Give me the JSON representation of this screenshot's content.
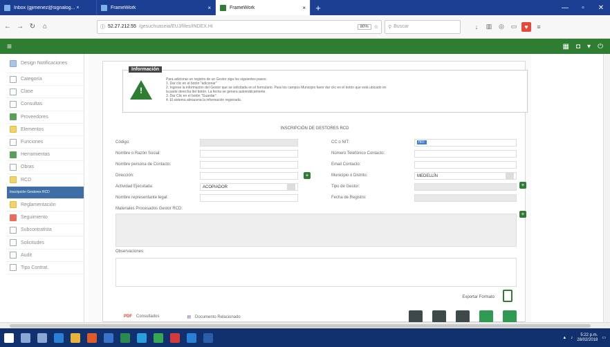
{
  "browser": {
    "tabs": [
      {
        "label": "Inbox (gjimenez@signalog... ×"
      },
      {
        "label": "FrameWork"
      },
      {
        "label": "FrameWork"
      }
    ],
    "url_host": "52.27.212.55",
    "url_path": "/gesuchuaseia/EUJ/files/INDEX.HI",
    "zoom": "80%",
    "search_placeholder": "Buscar"
  },
  "sidebar": {
    "items": [
      {
        "label": "Design Notificaciones",
        "icon": "bell-icon",
        "color": "blue"
      },
      {
        "label": "Categoría",
        "icon": "list-icon",
        "color": ""
      },
      {
        "label": "Clase",
        "icon": "tag-icon",
        "color": ""
      },
      {
        "label": "Consultas",
        "icon": "search-icon",
        "color": ""
      },
      {
        "label": "Proveedores",
        "icon": "chart-icon",
        "color": "green"
      },
      {
        "label": "Elementos",
        "icon": "cube-icon",
        "color": "yellow"
      },
      {
        "label": "Funciones",
        "icon": "grid-icon",
        "color": ""
      },
      {
        "label": "Herramientas",
        "icon": "wrench-icon",
        "color": "green"
      },
      {
        "label": "Obras",
        "icon": "building-icon",
        "color": ""
      },
      {
        "label": "RCD",
        "icon": "folder-icon",
        "color": "yellow"
      },
      {
        "label": "Inscripción Gestores RCD",
        "icon": "",
        "color": "",
        "active": true
      },
      {
        "label": "Reglamentación",
        "icon": "pen-icon",
        "color": "yellow"
      },
      {
        "label": "Seguimiento",
        "icon": "truck-icon",
        "color": "red"
      },
      {
        "label": "Subcontratista",
        "icon": "users-icon",
        "color": ""
      },
      {
        "label": "Solicitudes",
        "icon": "doc-icon",
        "color": ""
      },
      {
        "label": "Audit",
        "icon": "check-icon",
        "color": ""
      },
      {
        "label": "Tipo Contrat.",
        "icon": "contract-icon",
        "color": ""
      }
    ]
  },
  "info": {
    "title": "Información",
    "lines": [
      "Para adicionar un registro de un Gestor siga los siguientes pasos:",
      "1. Dar clic en el botón \"adicionar\"",
      "2. Ingrese la información del Gestor que se solicitada en el formulario. Para los campos Municipio favor dar clic en el botón que está ubicado en",
      "la parte derecha del botón. La fecha se genera automáticamente.",
      "3. Dar Clic en el botón \"Guardar\".",
      "4. El sistema almacena la información registrada."
    ]
  },
  "form": {
    "title": "INSCRIPCIÓN DE GESTORES RCD",
    "labels": {
      "codigo": "Código:",
      "nombre_razon": "Nombre o Razón Social:",
      "nombre_contacto": "Nombre persona de Contacto:",
      "direccion": "Dirección:",
      "actividad": "Actividad Ejecutada:",
      "representante": "Nombre representante legal:",
      "cc_nit": "CC o NIT:",
      "telefono": "Número Telefónico Contacto:",
      "email": "Email Contacto:",
      "municipio": "Municipio o Distrito:",
      "tipo_gestor": "Tipo de Gestor:",
      "fecha_registro": "Fecha de Registro:",
      "materiales": "Materiales Procesados Gestor RCD:",
      "observaciones": "Observaciones:"
    },
    "values": {
      "cc_nit": "NIT",
      "actividad": "ACOPIADOR",
      "municipio": "MEDELLÍN"
    }
  },
  "footer": {
    "export_label": "Exportar Formato",
    "link_consultados": "Consultados",
    "link_documento": "Documento Relacionado"
  },
  "taskbar": {
    "time": "5:22 p.m.",
    "date": "28/02/2018"
  }
}
